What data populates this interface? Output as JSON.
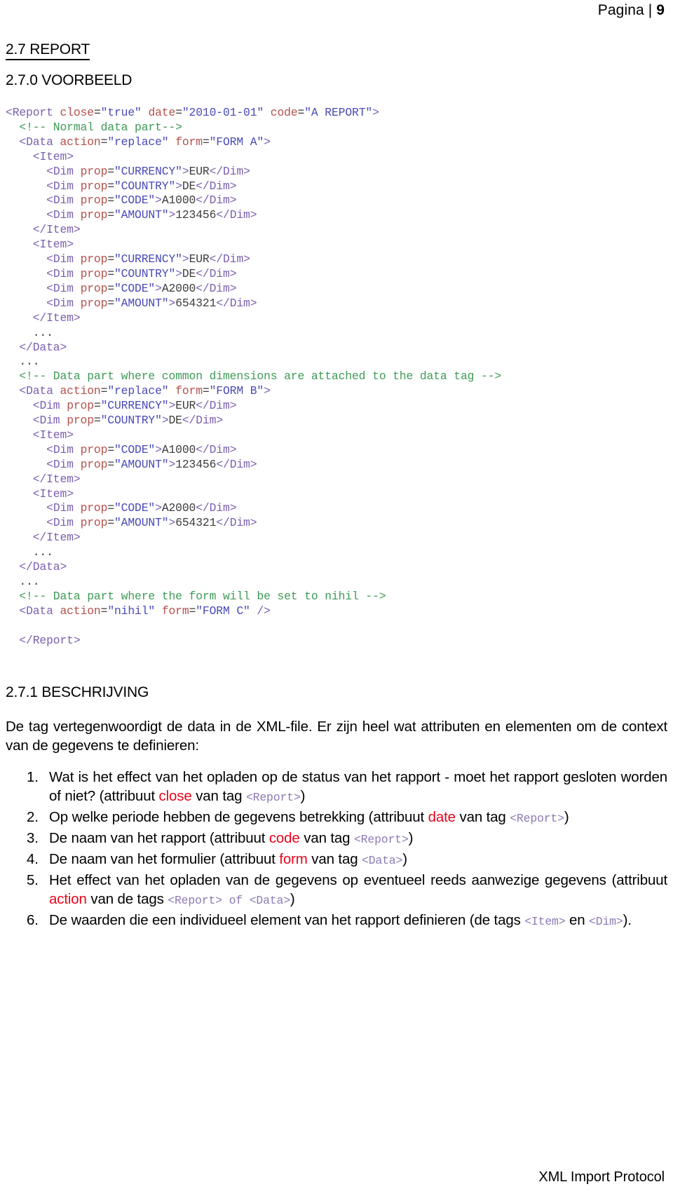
{
  "header": {
    "label": "Pagina |",
    "page_number": "9"
  },
  "headings": {
    "section": "2.7 REPORT",
    "subsection": "2.7.0 VOORBEELD",
    "description": "2.7.1 BESCHRIJVING"
  },
  "code": {
    "lines": [
      [
        {
          "t": "punct",
          "s": "<"
        },
        {
          "t": "tag",
          "s": "Report"
        },
        {
          "t": "txt",
          "s": " "
        },
        {
          "t": "attr",
          "s": "close"
        },
        {
          "t": "txt",
          "s": "="
        },
        {
          "t": "val",
          "s": "\"true\""
        },
        {
          "t": "txt",
          "s": " "
        },
        {
          "t": "attr",
          "s": "date"
        },
        {
          "t": "txt",
          "s": "="
        },
        {
          "t": "val",
          "s": "\"2010-01-01\""
        },
        {
          "t": "txt",
          "s": " "
        },
        {
          "t": "attr",
          "s": "code"
        },
        {
          "t": "txt",
          "s": "="
        },
        {
          "t": "val",
          "s": "\"A REPORT\""
        },
        {
          "t": "punct",
          "s": ">"
        }
      ],
      [
        {
          "t": "comment",
          "s": "  <!-- Normal data part-->"
        }
      ],
      [
        {
          "t": "punct",
          "s": "  <"
        },
        {
          "t": "tag",
          "s": "Data"
        },
        {
          "t": "txt",
          "s": " "
        },
        {
          "t": "attr",
          "s": "action"
        },
        {
          "t": "txt",
          "s": "="
        },
        {
          "t": "val",
          "s": "\"replace\""
        },
        {
          "t": "txt",
          "s": " "
        },
        {
          "t": "attr",
          "s": "form"
        },
        {
          "t": "txt",
          "s": "="
        },
        {
          "t": "val",
          "s": "\"FORM A\""
        },
        {
          "t": "punct",
          "s": ">"
        }
      ],
      [
        {
          "t": "punct",
          "s": "    <"
        },
        {
          "t": "tag",
          "s": "Item"
        },
        {
          "t": "punct",
          "s": ">"
        }
      ],
      [
        {
          "t": "punct",
          "s": "      <"
        },
        {
          "t": "tag",
          "s": "Dim"
        },
        {
          "t": "txt",
          "s": " "
        },
        {
          "t": "attr",
          "s": "prop"
        },
        {
          "t": "txt",
          "s": "="
        },
        {
          "t": "val",
          "s": "\"CURRENCY\""
        },
        {
          "t": "punct",
          "s": ">"
        },
        {
          "t": "txt",
          "s": "EUR"
        },
        {
          "t": "punct",
          "s": "</"
        },
        {
          "t": "tag",
          "s": "Dim"
        },
        {
          "t": "punct",
          "s": ">"
        }
      ],
      [
        {
          "t": "punct",
          "s": "      <"
        },
        {
          "t": "tag",
          "s": "Dim"
        },
        {
          "t": "txt",
          "s": " "
        },
        {
          "t": "attr",
          "s": "prop"
        },
        {
          "t": "txt",
          "s": "="
        },
        {
          "t": "val",
          "s": "\"COUNTRY\""
        },
        {
          "t": "punct",
          "s": ">"
        },
        {
          "t": "txt",
          "s": "DE"
        },
        {
          "t": "punct",
          "s": "</"
        },
        {
          "t": "tag",
          "s": "Dim"
        },
        {
          "t": "punct",
          "s": ">"
        }
      ],
      [
        {
          "t": "punct",
          "s": "      <"
        },
        {
          "t": "tag",
          "s": "Dim"
        },
        {
          "t": "txt",
          "s": " "
        },
        {
          "t": "attr",
          "s": "prop"
        },
        {
          "t": "txt",
          "s": "="
        },
        {
          "t": "val",
          "s": "\"CODE\""
        },
        {
          "t": "punct",
          "s": ">"
        },
        {
          "t": "txt",
          "s": "A1000"
        },
        {
          "t": "punct",
          "s": "</"
        },
        {
          "t": "tag",
          "s": "Dim"
        },
        {
          "t": "punct",
          "s": ">"
        }
      ],
      [
        {
          "t": "punct",
          "s": "      <"
        },
        {
          "t": "tag",
          "s": "Dim"
        },
        {
          "t": "txt",
          "s": " "
        },
        {
          "t": "attr",
          "s": "prop"
        },
        {
          "t": "txt",
          "s": "="
        },
        {
          "t": "val",
          "s": "\"AMOUNT\""
        },
        {
          "t": "punct",
          "s": ">"
        },
        {
          "t": "txt",
          "s": "123456"
        },
        {
          "t": "punct",
          "s": "</"
        },
        {
          "t": "tag",
          "s": "Dim"
        },
        {
          "t": "punct",
          "s": ">"
        }
      ],
      [
        {
          "t": "punct",
          "s": "    </"
        },
        {
          "t": "tag",
          "s": "Item"
        },
        {
          "t": "punct",
          "s": ">"
        }
      ],
      [
        {
          "t": "punct",
          "s": "    <"
        },
        {
          "t": "tag",
          "s": "Item"
        },
        {
          "t": "punct",
          "s": ">"
        }
      ],
      [
        {
          "t": "punct",
          "s": "      <"
        },
        {
          "t": "tag",
          "s": "Dim"
        },
        {
          "t": "txt",
          "s": " "
        },
        {
          "t": "attr",
          "s": "prop"
        },
        {
          "t": "txt",
          "s": "="
        },
        {
          "t": "val",
          "s": "\"CURRENCY\""
        },
        {
          "t": "punct",
          "s": ">"
        },
        {
          "t": "txt",
          "s": "EUR"
        },
        {
          "t": "punct",
          "s": "</"
        },
        {
          "t": "tag",
          "s": "Dim"
        },
        {
          "t": "punct",
          "s": ">"
        }
      ],
      [
        {
          "t": "punct",
          "s": "      <"
        },
        {
          "t": "tag",
          "s": "Dim"
        },
        {
          "t": "txt",
          "s": " "
        },
        {
          "t": "attr",
          "s": "prop"
        },
        {
          "t": "txt",
          "s": "="
        },
        {
          "t": "val",
          "s": "\"COUNTRY\""
        },
        {
          "t": "punct",
          "s": ">"
        },
        {
          "t": "txt",
          "s": "DE"
        },
        {
          "t": "punct",
          "s": "</"
        },
        {
          "t": "tag",
          "s": "Dim"
        },
        {
          "t": "punct",
          "s": ">"
        }
      ],
      [
        {
          "t": "punct",
          "s": "      <"
        },
        {
          "t": "tag",
          "s": "Dim"
        },
        {
          "t": "txt",
          "s": " "
        },
        {
          "t": "attr",
          "s": "prop"
        },
        {
          "t": "txt",
          "s": "="
        },
        {
          "t": "val",
          "s": "\"CODE\""
        },
        {
          "t": "punct",
          "s": ">"
        },
        {
          "t": "txt",
          "s": "A2000"
        },
        {
          "t": "punct",
          "s": "</"
        },
        {
          "t": "tag",
          "s": "Dim"
        },
        {
          "t": "punct",
          "s": ">"
        }
      ],
      [
        {
          "t": "punct",
          "s": "      <"
        },
        {
          "t": "tag",
          "s": "Dim"
        },
        {
          "t": "txt",
          "s": " "
        },
        {
          "t": "attr",
          "s": "prop"
        },
        {
          "t": "txt",
          "s": "="
        },
        {
          "t": "val",
          "s": "\"AMOUNT\""
        },
        {
          "t": "punct",
          "s": ">"
        },
        {
          "t": "txt",
          "s": "654321"
        },
        {
          "t": "punct",
          "s": "</"
        },
        {
          "t": "tag",
          "s": "Dim"
        },
        {
          "t": "punct",
          "s": ">"
        }
      ],
      [
        {
          "t": "punct",
          "s": "    </"
        },
        {
          "t": "tag",
          "s": "Item"
        },
        {
          "t": "punct",
          "s": ">"
        }
      ],
      [
        {
          "t": "txt",
          "s": "    ..."
        }
      ],
      [
        {
          "t": "punct",
          "s": "  </"
        },
        {
          "t": "tag",
          "s": "Data"
        },
        {
          "t": "punct",
          "s": ">"
        }
      ],
      [
        {
          "t": "txt",
          "s": "  ..."
        }
      ],
      [
        {
          "t": "comment",
          "s": "  <!-- Data part where common dimensions are attached to the data tag -->"
        }
      ],
      [
        {
          "t": "punct",
          "s": "  <"
        },
        {
          "t": "tag",
          "s": "Data"
        },
        {
          "t": "txt",
          "s": " "
        },
        {
          "t": "attr",
          "s": "action"
        },
        {
          "t": "txt",
          "s": "="
        },
        {
          "t": "val",
          "s": "\"replace\""
        },
        {
          "t": "txt",
          "s": " "
        },
        {
          "t": "attr",
          "s": "form"
        },
        {
          "t": "txt",
          "s": "="
        },
        {
          "t": "val",
          "s": "\"FORM B\""
        },
        {
          "t": "punct",
          "s": ">"
        }
      ],
      [
        {
          "t": "punct",
          "s": "    <"
        },
        {
          "t": "tag",
          "s": "Dim"
        },
        {
          "t": "txt",
          "s": " "
        },
        {
          "t": "attr",
          "s": "prop"
        },
        {
          "t": "txt",
          "s": "="
        },
        {
          "t": "val",
          "s": "\"CURRENCY\""
        },
        {
          "t": "punct",
          "s": ">"
        },
        {
          "t": "txt",
          "s": "EUR"
        },
        {
          "t": "punct",
          "s": "</"
        },
        {
          "t": "tag",
          "s": "Dim"
        },
        {
          "t": "punct",
          "s": ">"
        }
      ],
      [
        {
          "t": "punct",
          "s": "    <"
        },
        {
          "t": "tag",
          "s": "Dim"
        },
        {
          "t": "txt",
          "s": " "
        },
        {
          "t": "attr",
          "s": "prop"
        },
        {
          "t": "txt",
          "s": "="
        },
        {
          "t": "val",
          "s": "\"COUNTRY\""
        },
        {
          "t": "punct",
          "s": ">"
        },
        {
          "t": "txt",
          "s": "DE"
        },
        {
          "t": "punct",
          "s": "</"
        },
        {
          "t": "tag",
          "s": "Dim"
        },
        {
          "t": "punct",
          "s": ">"
        }
      ],
      [
        {
          "t": "punct",
          "s": "    <"
        },
        {
          "t": "tag",
          "s": "Item"
        },
        {
          "t": "punct",
          "s": ">"
        }
      ],
      [
        {
          "t": "punct",
          "s": "      <"
        },
        {
          "t": "tag",
          "s": "Dim"
        },
        {
          "t": "txt",
          "s": " "
        },
        {
          "t": "attr",
          "s": "prop"
        },
        {
          "t": "txt",
          "s": "="
        },
        {
          "t": "val",
          "s": "\"CODE\""
        },
        {
          "t": "punct",
          "s": ">"
        },
        {
          "t": "txt",
          "s": "A1000"
        },
        {
          "t": "punct",
          "s": "</"
        },
        {
          "t": "tag",
          "s": "Dim"
        },
        {
          "t": "punct",
          "s": ">"
        }
      ],
      [
        {
          "t": "punct",
          "s": "      <"
        },
        {
          "t": "tag",
          "s": "Dim"
        },
        {
          "t": "txt",
          "s": " "
        },
        {
          "t": "attr",
          "s": "prop"
        },
        {
          "t": "txt",
          "s": "="
        },
        {
          "t": "val",
          "s": "\"AMOUNT\""
        },
        {
          "t": "punct",
          "s": ">"
        },
        {
          "t": "txt",
          "s": "123456"
        },
        {
          "t": "punct",
          "s": "</"
        },
        {
          "t": "tag",
          "s": "Dim"
        },
        {
          "t": "punct",
          "s": ">"
        }
      ],
      [
        {
          "t": "punct",
          "s": "    </"
        },
        {
          "t": "tag",
          "s": "Item"
        },
        {
          "t": "punct",
          "s": ">"
        }
      ],
      [
        {
          "t": "punct",
          "s": "    <"
        },
        {
          "t": "tag",
          "s": "Item"
        },
        {
          "t": "punct",
          "s": ">"
        }
      ],
      [
        {
          "t": "punct",
          "s": "      <"
        },
        {
          "t": "tag",
          "s": "Dim"
        },
        {
          "t": "txt",
          "s": " "
        },
        {
          "t": "attr",
          "s": "prop"
        },
        {
          "t": "txt",
          "s": "="
        },
        {
          "t": "val",
          "s": "\"CODE\""
        },
        {
          "t": "punct",
          "s": ">"
        },
        {
          "t": "txt",
          "s": "A2000"
        },
        {
          "t": "punct",
          "s": "</"
        },
        {
          "t": "tag",
          "s": "Dim"
        },
        {
          "t": "punct",
          "s": ">"
        }
      ],
      [
        {
          "t": "punct",
          "s": "      <"
        },
        {
          "t": "tag",
          "s": "Dim"
        },
        {
          "t": "txt",
          "s": " "
        },
        {
          "t": "attr",
          "s": "prop"
        },
        {
          "t": "txt",
          "s": "="
        },
        {
          "t": "val",
          "s": "\"AMOUNT\""
        },
        {
          "t": "punct",
          "s": ">"
        },
        {
          "t": "txt",
          "s": "654321"
        },
        {
          "t": "punct",
          "s": "</"
        },
        {
          "t": "tag",
          "s": "Dim"
        },
        {
          "t": "punct",
          "s": ">"
        }
      ],
      [
        {
          "t": "punct",
          "s": "    </"
        },
        {
          "t": "tag",
          "s": "Item"
        },
        {
          "t": "punct",
          "s": ">"
        }
      ],
      [
        {
          "t": "txt",
          "s": "    ..."
        }
      ],
      [
        {
          "t": "punct",
          "s": "  </"
        },
        {
          "t": "tag",
          "s": "Data"
        },
        {
          "t": "punct",
          "s": ">"
        }
      ],
      [
        {
          "t": "txt",
          "s": "  ..."
        }
      ],
      [
        {
          "t": "comment",
          "s": "  <!-- Data part where the form will be set to nihil -->"
        }
      ],
      [
        {
          "t": "punct",
          "s": "  <"
        },
        {
          "t": "tag",
          "s": "Data"
        },
        {
          "t": "txt",
          "s": " "
        },
        {
          "t": "attr",
          "s": "action"
        },
        {
          "t": "txt",
          "s": "="
        },
        {
          "t": "val",
          "s": "\"nihil\""
        },
        {
          "t": "txt",
          "s": " "
        },
        {
          "t": "attr",
          "s": "form"
        },
        {
          "t": "txt",
          "s": "="
        },
        {
          "t": "val",
          "s": "\"FORM C\""
        },
        {
          "t": "punct",
          "s": " />"
        }
      ],
      [
        {
          "t": "txt",
          "s": ""
        }
      ],
      [
        {
          "t": "punct",
          "s": "  </"
        },
        {
          "t": "tag",
          "s": "Report"
        },
        {
          "t": "punct",
          "s": ">"
        }
      ]
    ]
  },
  "description": {
    "intro": "De tag vertegenwoordigt de data in de XML-file. Er zijn heel wat attributen en elementen om de context van de gegevens te definieren:",
    "items": [
      [
        {
          "t": "plain",
          "s": "Wat is het effect van het opladen op de status van het rapport - moet het rapport gesloten worden of niet? (attribuut "
        },
        {
          "t": "kw",
          "s": "close"
        },
        {
          "t": "plain",
          "s": " van tag "
        },
        {
          "t": "tagref",
          "s": "<Report>"
        },
        {
          "t": "plain",
          "s": ")"
        }
      ],
      [
        {
          "t": "plain",
          "s": "Op welke periode hebben de gegevens betrekking (attribuut "
        },
        {
          "t": "kw",
          "s": "date"
        },
        {
          "t": "plain",
          "s": " van tag "
        },
        {
          "t": "tagref",
          "s": "<Report>"
        },
        {
          "t": "plain",
          "s": ")"
        }
      ],
      [
        {
          "t": "plain",
          "s": "De naam van het rapport (attribuut "
        },
        {
          "t": "kw",
          "s": "code"
        },
        {
          "t": "plain",
          "s": " van tag "
        },
        {
          "t": "tagref",
          "s": "<Report>"
        },
        {
          "t": "plain",
          "s": ")"
        }
      ],
      [
        {
          "t": "plain",
          "s": "De naam van het formulier (attribuut "
        },
        {
          "t": "kw",
          "s": "form"
        },
        {
          "t": "plain",
          "s": " van tag "
        },
        {
          "t": "tagref",
          "s": "<Data>"
        },
        {
          "t": "plain",
          "s": ")"
        }
      ],
      [
        {
          "t": "plain",
          "s": "Het effect van het opladen van de gegevens op eventueel reeds aanwezige gegevens (attribuut "
        },
        {
          "t": "kw",
          "s": "action"
        },
        {
          "t": "plain",
          "s": " van de tags "
        },
        {
          "t": "tagref",
          "s": "<Report>"
        },
        {
          "t": "mono",
          "s": " of "
        },
        {
          "t": "tagref",
          "s": "<Data>"
        },
        {
          "t": "plain",
          "s": ")"
        }
      ],
      [
        {
          "t": "plain",
          "s": "De waarden die een individueel element van het rapport definieren (de tags "
        },
        {
          "t": "tagref",
          "s": "<Item>"
        },
        {
          "t": "plain",
          "s": " en "
        },
        {
          "t": "tagref",
          "s": "<Dim>"
        },
        {
          "t": "plain",
          "s": ")."
        }
      ]
    ]
  },
  "footer": {
    "text": "XML Import Protocol"
  }
}
